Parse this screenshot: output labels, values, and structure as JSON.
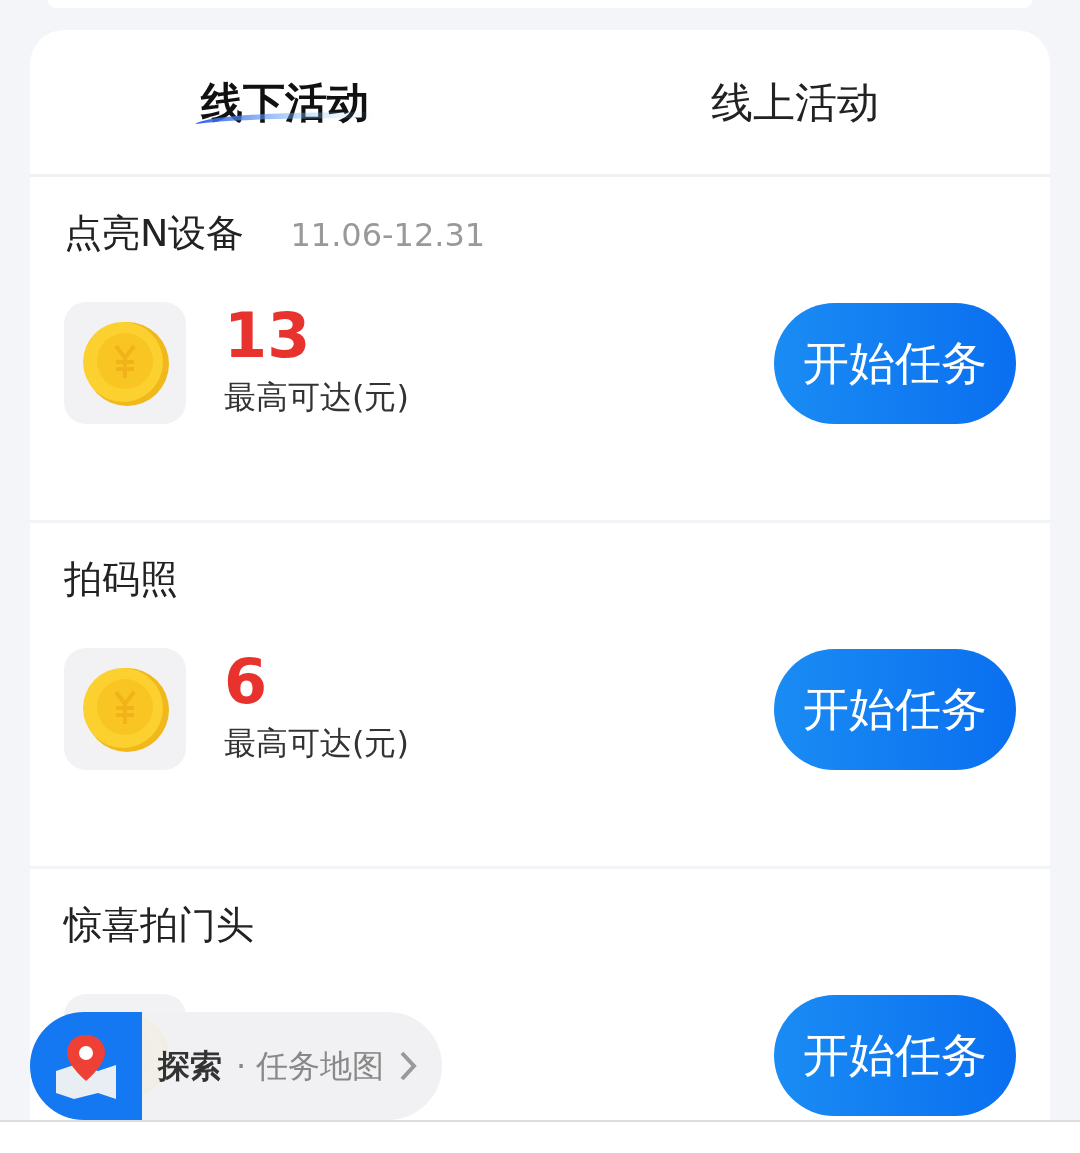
{
  "tabs": [
    {
      "label": "线下活动",
      "selected": true
    },
    {
      "label": "线上活动",
      "selected": false
    }
  ],
  "tasks": [
    {
      "title": "点亮N设备",
      "date": "11.06-12.31",
      "amount": "13",
      "amount_label": "最高可达(元)",
      "button": "开始任务"
    },
    {
      "title": "拍码照",
      "amount": "6",
      "amount_label": "最高可达(元)",
      "button": "开始任务"
    },
    {
      "title": "惊喜拍门头",
      "button": "开始任务"
    }
  ],
  "map_bar": {
    "label": "探索",
    "sublabel": "· 任务地图"
  }
}
